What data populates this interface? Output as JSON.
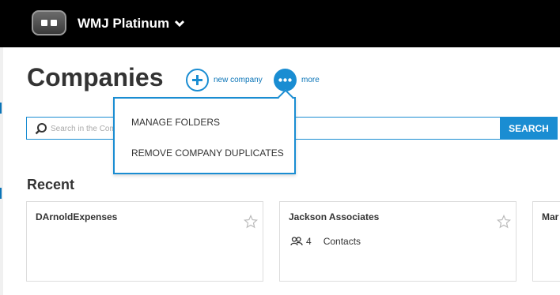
{
  "header": {
    "account_name": "WMJ Platinum"
  },
  "page": {
    "title": "Companies"
  },
  "actions": {
    "new_company": "new company",
    "more": "more"
  },
  "search": {
    "placeholder": "Search in the Company name, or other fields.",
    "button": "SEARCH"
  },
  "more_menu": {
    "items": [
      "MANAGE FOLDERS",
      "REMOVE COMPANY DUPLICATES"
    ]
  },
  "recent": {
    "title": "Recent",
    "cards": [
      {
        "name": "DArnoldExpenses"
      },
      {
        "name": "Jackson Associates",
        "count": "4",
        "count_label": "Contacts"
      },
      {
        "name": "Mar"
      }
    ]
  },
  "colors": {
    "accent": "#1a8dd2",
    "topbar": "#000000"
  }
}
